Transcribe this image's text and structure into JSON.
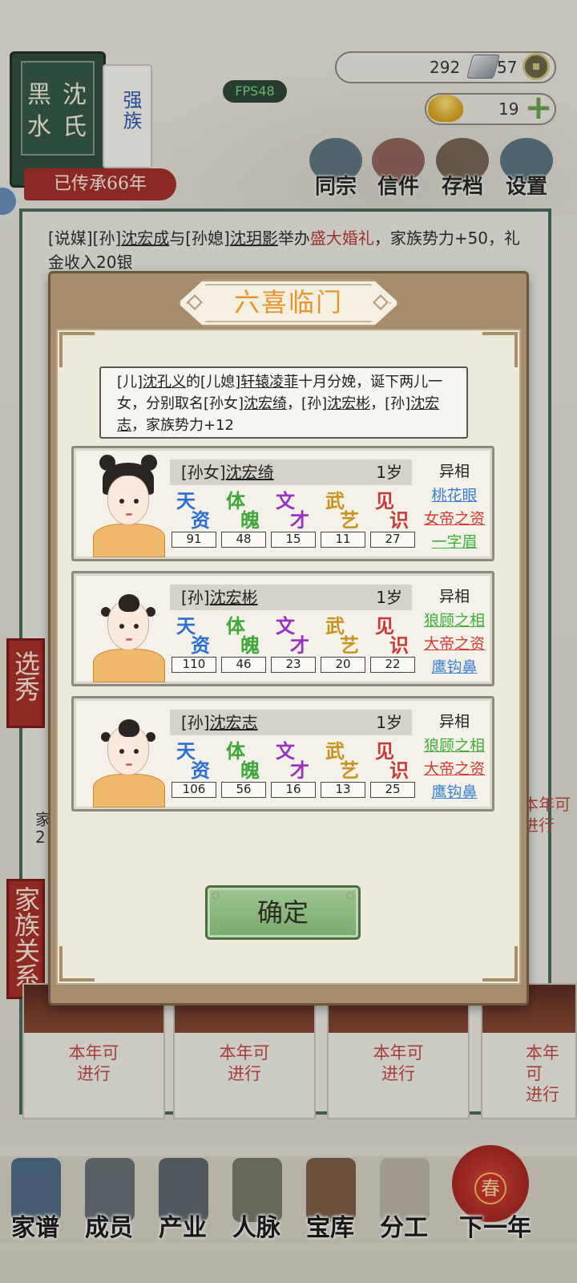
{
  "status": {
    "fps": "FPS48"
  },
  "family": {
    "book_left_chars": [
      "黑",
      "水"
    ],
    "book_right_chars": [
      "沈",
      "氏"
    ],
    "rank": "强族",
    "heritage": "已传承66年"
  },
  "currency": {
    "silver": "292",
    "coin": "57",
    "gold": "19"
  },
  "top_menu": [
    {
      "label": "同宗",
      "icon": "clan-book-icon"
    },
    {
      "label": "信件",
      "icon": "letter-icon"
    },
    {
      "label": "存档",
      "icon": "archive-icon"
    },
    {
      "label": "设置",
      "icon": "gear-icon"
    }
  ],
  "log": {
    "prefix1": "[说媒][孙]",
    "name1": "沈宏成",
    "mid1": "与[孙媳]",
    "name2": "沈玥影",
    "mid2": "举办",
    "highlight": "盛大婚礼",
    "suffix": "，家族势力+50，礼金收入20银"
  },
  "side": {
    "tag1": "选秀",
    "tag2": "家族关系",
    "card_text1": "家",
    "card_text2": "2",
    "right_card": "本年可进行"
  },
  "actions": [
    {
      "line1": "本年可",
      "line2": "进行"
    },
    {
      "line1": "本年可",
      "line2": "进行"
    },
    {
      "line1": "本年可",
      "line2": "进行"
    },
    {
      "line1": "本年可",
      "line2": "进行"
    }
  ],
  "bottom_nav": [
    {
      "label": "家谱",
      "icon": "genealogy-icon"
    },
    {
      "label": "成员",
      "icon": "member-icon"
    },
    {
      "label": "产业",
      "icon": "industry-icon"
    },
    {
      "label": "人脉",
      "icon": "network-icon"
    },
    {
      "label": "宝库",
      "icon": "treasury-icon"
    },
    {
      "label": "分工",
      "icon": "scroll-icon"
    },
    {
      "label": "下一年",
      "icon": "lantern-icon"
    }
  ],
  "spring_char": "春",
  "dialog": {
    "title": "六喜临门",
    "event": {
      "p1": "[儿]",
      "n1": "沈孔义",
      "p2": "的[儿媳]",
      "n2": "轩辕凌菲",
      "p3": "十月分娩，诞下两儿一女，分别取名[孙女]",
      "n3": "沈宏绮",
      "p4": "，[孙]",
      "n4": "沈宏彬",
      "p5": "，[孙]",
      "n5": "沈宏志",
      "p6": "，家族势力+12"
    },
    "stat_labels": [
      {
        "a": "天",
        "b": "资",
        "color": "#2f6fd0"
      },
      {
        "a": "体",
        "b": "魄",
        "color": "#3fa83a"
      },
      {
        "a": "文",
        "b": "才",
        "color": "#9a2fc0"
      },
      {
        "a": "武",
        "b": "艺",
        "color": "#c9921e"
      },
      {
        "a": "见",
        "b": "识",
        "color": "#c83a3a"
      }
    ],
    "traits_header": "异相",
    "children": [
      {
        "relation": "[孙女]",
        "name": "沈宏绮",
        "age": "1岁",
        "gender": "girl",
        "stats": [
          "91",
          "48",
          "15",
          "11",
          "27"
        ],
        "traits": [
          {
            "text": "桃花眼",
            "color": "#3a7fd0"
          },
          {
            "text": "女帝之资",
            "color": "#d23b35"
          },
          {
            "text": "一字眉",
            "color": "#3fae3a"
          }
        ]
      },
      {
        "relation": "[孙]",
        "name": "沈宏彬",
        "age": "1岁",
        "gender": "boy",
        "stats": [
          "110",
          "46",
          "23",
          "20",
          "22"
        ],
        "traits": [
          {
            "text": "狼顾之相",
            "color": "#3fae3a"
          },
          {
            "text": "大帝之资",
            "color": "#d23b35"
          },
          {
            "text": "鹰钩鼻",
            "color": "#3a7fd0"
          }
        ]
      },
      {
        "relation": "[孙]",
        "name": "沈宏志",
        "age": "1岁",
        "gender": "boy",
        "stats": [
          "106",
          "56",
          "16",
          "13",
          "25"
        ],
        "traits": [
          {
            "text": "狼顾之相",
            "color": "#3fae3a"
          },
          {
            "text": "大帝之资",
            "color": "#d23b35"
          },
          {
            "text": "鹰钩鼻",
            "color": "#3a7fd0"
          }
        ]
      }
    ],
    "confirm_label": "确定"
  }
}
